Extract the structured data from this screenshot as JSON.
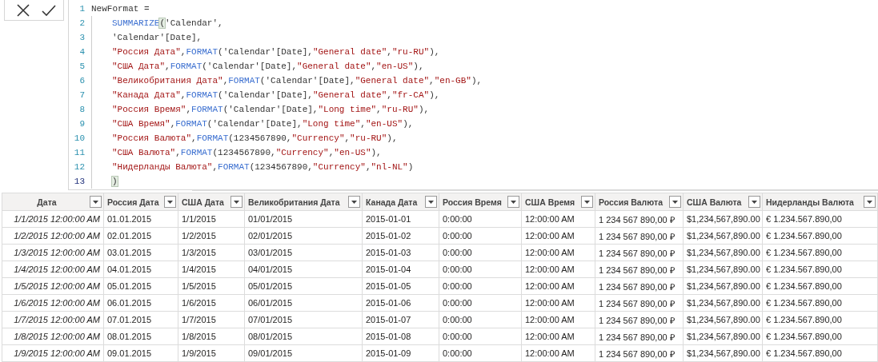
{
  "formula_bar": {
    "buttons": [
      {
        "kind": "cancel"
      },
      {
        "kind": "commit"
      }
    ],
    "lines": [
      {
        "number": "1",
        "indented": false,
        "current": false,
        "tokens": [
          {
            "kind": "plain",
            "text": "NewFormat ="
          }
        ]
      },
      {
        "number": "2",
        "indented": true,
        "current": false,
        "tokens": [
          {
            "kind": "fn",
            "text": "SUMMARIZE"
          },
          {
            "kind": "bracket",
            "text": "("
          },
          {
            "kind": "plain",
            "text": "'Calendar',"
          }
        ]
      },
      {
        "number": "3",
        "indented": true,
        "current": false,
        "tokens": [
          {
            "kind": "plain",
            "text": "'Calendar'[Date],"
          }
        ]
      },
      {
        "number": "4",
        "indented": true,
        "current": false,
        "tokens": [
          {
            "kind": "str",
            "text": "\"Россия Дата\""
          },
          {
            "kind": "plain",
            "text": ","
          },
          {
            "kind": "fn",
            "text": "FORMAT"
          },
          {
            "kind": "plain",
            "text": "('Calendar'[Date],"
          },
          {
            "kind": "str",
            "text": "\"General date\""
          },
          {
            "kind": "plain",
            "text": ","
          },
          {
            "kind": "str",
            "text": "\"ru-RU\""
          },
          {
            "kind": "plain",
            "text": "),"
          }
        ]
      },
      {
        "number": "5",
        "indented": true,
        "current": false,
        "tokens": [
          {
            "kind": "str",
            "text": "\"США Дата\""
          },
          {
            "kind": "plain",
            "text": ","
          },
          {
            "kind": "fn",
            "text": "FORMAT"
          },
          {
            "kind": "plain",
            "text": "('Calendar'[Date],"
          },
          {
            "kind": "str",
            "text": "\"General date\""
          },
          {
            "kind": "plain",
            "text": ","
          },
          {
            "kind": "str",
            "text": "\"en-US\""
          },
          {
            "kind": "plain",
            "text": "),"
          }
        ]
      },
      {
        "number": "6",
        "indented": true,
        "current": false,
        "tokens": [
          {
            "kind": "str",
            "text": "\"Великобритания Дата\""
          },
          {
            "kind": "plain",
            "text": ","
          },
          {
            "kind": "fn",
            "text": "FORMAT"
          },
          {
            "kind": "plain",
            "text": "('Calendar'[Date],"
          },
          {
            "kind": "str",
            "text": "\"General date\""
          },
          {
            "kind": "plain",
            "text": ","
          },
          {
            "kind": "str",
            "text": "\"en-GB\""
          },
          {
            "kind": "plain",
            "text": "),"
          }
        ]
      },
      {
        "number": "7",
        "indented": true,
        "current": false,
        "tokens": [
          {
            "kind": "str",
            "text": "\"Канада Дата\""
          },
          {
            "kind": "plain",
            "text": ","
          },
          {
            "kind": "fn",
            "text": "FORMAT"
          },
          {
            "kind": "plain",
            "text": "('Calendar'[Date],"
          },
          {
            "kind": "str",
            "text": "\"General date\""
          },
          {
            "kind": "plain",
            "text": ","
          },
          {
            "kind": "str",
            "text": "\"fr-CA\""
          },
          {
            "kind": "plain",
            "text": "),"
          }
        ]
      },
      {
        "number": "8",
        "indented": true,
        "current": false,
        "tokens": [
          {
            "kind": "str",
            "text": "\"Россия Время\""
          },
          {
            "kind": "plain",
            "text": ","
          },
          {
            "kind": "fn",
            "text": "FORMAT"
          },
          {
            "kind": "plain",
            "text": "('Calendar'[Date],"
          },
          {
            "kind": "str",
            "text": "\"Long time\""
          },
          {
            "kind": "plain",
            "text": ","
          },
          {
            "kind": "str",
            "text": "\"ru-RU\""
          },
          {
            "kind": "plain",
            "text": "),"
          }
        ]
      },
      {
        "number": "9",
        "indented": true,
        "current": false,
        "tokens": [
          {
            "kind": "str",
            "text": "\"США Время\""
          },
          {
            "kind": "plain",
            "text": ","
          },
          {
            "kind": "fn",
            "text": "FORMAT"
          },
          {
            "kind": "plain",
            "text": "('Calendar'[Date],"
          },
          {
            "kind": "str",
            "text": "\"Long time\""
          },
          {
            "kind": "plain",
            "text": ","
          },
          {
            "kind": "str",
            "text": "\"en-US\""
          },
          {
            "kind": "plain",
            "text": "),"
          }
        ]
      },
      {
        "number": "10",
        "indented": true,
        "current": false,
        "tokens": [
          {
            "kind": "str",
            "text": "\"Россия Валюта\""
          },
          {
            "kind": "plain",
            "text": ","
          },
          {
            "kind": "fn",
            "text": "FORMAT"
          },
          {
            "kind": "plain",
            "text": "(1234567890,"
          },
          {
            "kind": "str",
            "text": "\"Currency\""
          },
          {
            "kind": "plain",
            "text": ","
          },
          {
            "kind": "str",
            "text": "\"ru-RU\""
          },
          {
            "kind": "plain",
            "text": "),"
          }
        ]
      },
      {
        "number": "11",
        "indented": true,
        "current": false,
        "tokens": [
          {
            "kind": "str",
            "text": "\"США Валюта\""
          },
          {
            "kind": "plain",
            "text": ","
          },
          {
            "kind": "fn",
            "text": "FORMAT"
          },
          {
            "kind": "plain",
            "text": "(1234567890,"
          },
          {
            "kind": "str",
            "text": "\"Currency\""
          },
          {
            "kind": "plain",
            "text": ","
          },
          {
            "kind": "str",
            "text": "\"en-US\""
          },
          {
            "kind": "plain",
            "text": "),"
          }
        ]
      },
      {
        "number": "12",
        "indented": true,
        "current": false,
        "tokens": [
          {
            "kind": "str",
            "text": "\"Нидерланды Валюта\""
          },
          {
            "kind": "plain",
            "text": ","
          },
          {
            "kind": "fn",
            "text": "FORMAT"
          },
          {
            "kind": "plain",
            "text": "(1234567890,"
          },
          {
            "kind": "str",
            "text": "\"Currency\""
          },
          {
            "kind": "plain",
            "text": ","
          },
          {
            "kind": "str",
            "text": "\"nl-NL\""
          },
          {
            "kind": "plain",
            "text": ")"
          }
        ]
      },
      {
        "number": "13",
        "indented": true,
        "current": true,
        "tokens": [
          {
            "kind": "bracket",
            "text": ")"
          }
        ]
      }
    ]
  },
  "table": {
    "columns": [
      "Дата",
      "Россия Дата",
      "США Дата",
      "Великобритания Дата",
      "Канада Дата",
      "Россия Время",
      "США Время",
      "Россия Валюта",
      "США Валюта",
      "Нидерланды Валюта"
    ],
    "rows": [
      [
        "1/1/2015 12:00:00 AM",
        "01.01.2015",
        "1/1/2015",
        "01/01/2015",
        "2015-01-01",
        "0:00:00",
        "12:00:00 AM",
        "1 234 567 890,00 ₽",
        "$1,234,567,890.00",
        "€ 1.234.567.890,00"
      ],
      [
        "1/2/2015 12:00:00 AM",
        "02.01.2015",
        "1/2/2015",
        "02/01/2015",
        "2015-01-02",
        "0:00:00",
        "12:00:00 AM",
        "1 234 567 890,00 ₽",
        "$1,234,567,890.00",
        "€ 1.234.567.890,00"
      ],
      [
        "1/3/2015 12:00:00 AM",
        "03.01.2015",
        "1/3/2015",
        "03/01/2015",
        "2015-01-03",
        "0:00:00",
        "12:00:00 AM",
        "1 234 567 890,00 ₽",
        "$1,234,567,890.00",
        "€ 1.234.567.890,00"
      ],
      [
        "1/4/2015 12:00:00 AM",
        "04.01.2015",
        "1/4/2015",
        "04/01/2015",
        "2015-01-04",
        "0:00:00",
        "12:00:00 AM",
        "1 234 567 890,00 ₽",
        "$1,234,567,890.00",
        "€ 1.234.567.890,00"
      ],
      [
        "1/5/2015 12:00:00 AM",
        "05.01.2015",
        "1/5/2015",
        "05/01/2015",
        "2015-01-05",
        "0:00:00",
        "12:00:00 AM",
        "1 234 567 890,00 ₽",
        "$1,234,567,890.00",
        "€ 1.234.567.890,00"
      ],
      [
        "1/6/2015 12:00:00 AM",
        "06.01.2015",
        "1/6/2015",
        "06/01/2015",
        "2015-01-06",
        "0:00:00",
        "12:00:00 AM",
        "1 234 567 890,00 ₽",
        "$1,234,567,890.00",
        "€ 1.234.567.890,00"
      ],
      [
        "1/7/2015 12:00:00 AM",
        "07.01.2015",
        "1/7/2015",
        "07/01/2015",
        "2015-01-07",
        "0:00:00",
        "12:00:00 AM",
        "1 234 567 890,00 ₽",
        "$1,234,567,890.00",
        "€ 1.234.567.890,00"
      ],
      [
        "1/8/2015 12:00:00 AM",
        "08.01.2015",
        "1/8/2015",
        "08/01/2015",
        "2015-01-08",
        "0:00:00",
        "12:00:00 AM",
        "1 234 567 890,00 ₽",
        "$1,234,567,890.00",
        "€ 1.234.567.890,00"
      ],
      [
        "1/9/2015 12:00:00 AM",
        "09.01.2015",
        "1/9/2015",
        "09/01/2015",
        "2015-01-09",
        "0:00:00",
        "12:00:00 AM",
        "1 234 567 890,00 ₽",
        "$1,234,567,890.00",
        "€ 1.234.567.890,00"
      ]
    ]
  }
}
